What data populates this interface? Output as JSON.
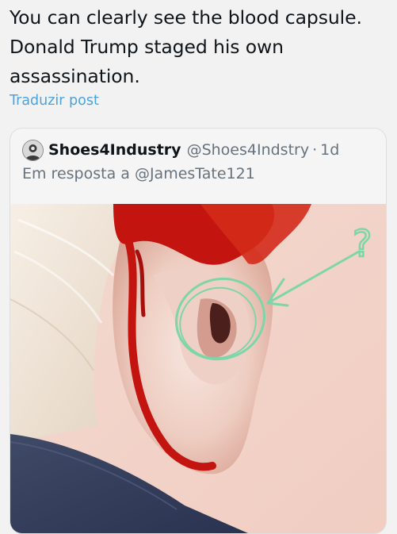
{
  "post": {
    "text_line1": "You can clearly see the blood capsule.",
    "text_line2": "Donald Trump staged his own",
    "text_line3": "assassination.",
    "translate_label": "Traduzir post"
  },
  "quote": {
    "author_name": "Shoes4Industry",
    "author_handle": "@Shoes4Indstry",
    "separator": "·",
    "time": "1d",
    "reply_prefix": "Em resposta a",
    "reply_handle": "@JamesTate121",
    "media_annotation_text": "?"
  },
  "colors": {
    "link": "#4aa3df",
    "secondary_text": "#66727d",
    "annotation": "#7ed6a8",
    "blood": "#c4140f"
  }
}
